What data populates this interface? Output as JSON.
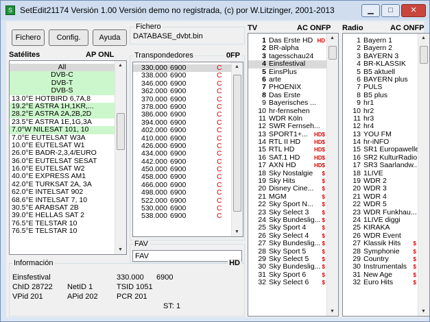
{
  "window": {
    "title": "SetEdit21174 Versión  1.00  Versión demo no registrada, (c) por W.Litzinger, 2001-2013",
    "min": "▁",
    "max": "□",
    "close": "✕"
  },
  "toolbar": {
    "fichero": "Fichero",
    "config": "Config.",
    "ayuda": "Ayuda",
    "file_group_label": "Fichero",
    "file_name": "DATABASE_dvbt.bin"
  },
  "satellites": {
    "label": "Satélites",
    "flags": "AP  ONL",
    "items": [
      {
        "t": "All",
        "c": "sel"
      },
      {
        "t": "DVB-C",
        "c": "green"
      },
      {
        "t": "DVB-T",
        "c": "green"
      },
      {
        "t": "DVB-S",
        "c": "green"
      },
      {
        "t": "13.0°E HOTBIRD 6,7A,8",
        "c": ""
      },
      {
        "t": "19.2°E ASTRA 1H,1KR,...",
        "c": "green"
      },
      {
        "t": "28.2°E ASTRA 2A,2B,2D",
        "c": "green"
      },
      {
        "t": "23.5°E ASTRA 1E,1G,3A",
        "c": ""
      },
      {
        "t": "7.0°W NILESAT 101, 10",
        "c": "green"
      },
      {
        "t": "7.0°E EUTELSAT W3A",
        "c": ""
      },
      {
        "t": "10.0°E EUTELSAT W1",
        "c": ""
      },
      {
        "t": "26.0°E BADR-2,3,4/EURO",
        "c": ""
      },
      {
        "t": "36.0°E EUTELSAT SESAT",
        "c": ""
      },
      {
        "t": "16.0°E EUTELSAT W2",
        "c": ""
      },
      {
        "t": "40.0°E EXPRESS AM1",
        "c": ""
      },
      {
        "t": "42.0°E TURKSAT 2A, 3A",
        "c": ""
      },
      {
        "t": "62.0°E INTELSAT 902",
        "c": ""
      },
      {
        "t": "68.6°E INTELSAT 7, 10",
        "c": ""
      },
      {
        "t": "30.5°E ARABSAT 2B",
        "c": ""
      },
      {
        "t": "39.0°E HELLAS SAT 2",
        "c": ""
      },
      {
        "t": "76.5°E TELSTAR 10",
        "c": ""
      },
      {
        "t": "76.5°E TELSTAR 10",
        "c": ""
      }
    ]
  },
  "transponders": {
    "label": "Transpondedores",
    "flags": "0FP",
    "items": [
      [
        "330.000",
        "6900",
        "C"
      ],
      [
        "338.000",
        "6900",
        "C"
      ],
      [
        "346.000",
        "6900",
        "C"
      ],
      [
        "362.000",
        "6900",
        "C"
      ],
      [
        "370.000",
        "6900",
        "C"
      ],
      [
        "378.000",
        "6900",
        "C"
      ],
      [
        "386.000",
        "6900",
        "C"
      ],
      [
        "394.000",
        "6900",
        "C"
      ],
      [
        "402.000",
        "6900",
        "C"
      ],
      [
        "410.000",
        "6900",
        "C"
      ],
      [
        "426.000",
        "6900",
        "C"
      ],
      [
        "434.000",
        "6900",
        "C"
      ],
      [
        "442.000",
        "6900",
        "C"
      ],
      [
        "450.000",
        "6900",
        "C"
      ],
      [
        "458.000",
        "6900",
        "C"
      ],
      [
        "466.000",
        "6900",
        "C"
      ],
      [
        "498.000",
        "6900",
        "C"
      ],
      [
        "522.000",
        "6900",
        "C"
      ],
      [
        "530.000",
        "6900",
        "C"
      ],
      [
        "538.000",
        "6900",
        "C"
      ]
    ]
  },
  "fav": {
    "label": "FAV",
    "value": "FAV"
  },
  "tv": {
    "label": "TV",
    "flags": "AC  ONFP",
    "items": [
      [
        "1",
        "Das Erste HD",
        "HD"
      ],
      [
        "2",
        "BR-alpha",
        ""
      ],
      [
        "3",
        "tagesschau24",
        ""
      ],
      [
        "4",
        "Einsfestival",
        ""
      ],
      [
        "5",
        "EinsPlus",
        ""
      ],
      [
        "6",
        "arte",
        ""
      ],
      [
        "7",
        "PHOENIX",
        ""
      ],
      [
        "8",
        "Das Erste",
        ""
      ],
      [
        "9",
        "Bayerisches ...",
        ""
      ],
      [
        "10",
        "hr-fernsehen",
        ""
      ],
      [
        "11",
        "WDR Köln",
        ""
      ],
      [
        "12",
        "SWR Fernseh...",
        ""
      ],
      [
        "13",
        "SPORT1+...",
        "HD$"
      ],
      [
        "14",
        "RTL II HD",
        "HD$"
      ],
      [
        "15",
        "RTL HD",
        "HD$"
      ],
      [
        "16",
        "SAT.1 HD",
        "HD$"
      ],
      [
        "17",
        "AXN HD",
        "HD$"
      ],
      [
        "18",
        "Sky Nostalgie",
        "$"
      ],
      [
        "19",
        "Sky Hits",
        "$"
      ],
      [
        "20",
        "Disney Cine...",
        "$"
      ],
      [
        "21",
        "MGM",
        "$"
      ],
      [
        "22",
        "Sky Sport N...",
        "$"
      ],
      [
        "23",
        "Sky Select 3",
        "$"
      ],
      [
        "24",
        "Sky Bundeslig...",
        "$"
      ],
      [
        "25",
        "Sky Sport 4",
        "$"
      ],
      [
        "26",
        "Sky Select 4",
        "$"
      ],
      [
        "27",
        "Sky Bundeslig...",
        "$"
      ],
      [
        "28",
        "Sky Sport 5",
        "$"
      ],
      [
        "29",
        "Sky Select 5",
        "$"
      ],
      [
        "30",
        "Sky Bundeslig...",
        "$"
      ],
      [
        "31",
        "Sky Sport 6",
        "$"
      ],
      [
        "32",
        "Sky Select 6",
        "$"
      ]
    ]
  },
  "radio": {
    "label": "Radio",
    "flags": "AC  ONFP",
    "items": [
      [
        "1",
        "Bayern 1",
        ""
      ],
      [
        "2",
        "Bayern 2",
        ""
      ],
      [
        "3",
        "BAYERN 3",
        ""
      ],
      [
        "4",
        "BR-KLASSIK",
        ""
      ],
      [
        "5",
        "B5 aktuell",
        ""
      ],
      [
        "6",
        "BAYERN plus",
        ""
      ],
      [
        "7",
        "PULS",
        ""
      ],
      [
        "8",
        "B5 plus",
        ""
      ],
      [
        "9",
        "hr1",
        ""
      ],
      [
        "10",
        "hr2",
        ""
      ],
      [
        "11",
        "hr3",
        ""
      ],
      [
        "12",
        "hr4",
        ""
      ],
      [
        "13",
        "YOU FM",
        ""
      ],
      [
        "14",
        "hr-iNFO",
        ""
      ],
      [
        "15",
        "SR1 Europawelle",
        ""
      ],
      [
        "16",
        "SR2 KulturRadio",
        ""
      ],
      [
        "17",
        "SR3 Saarlandw...",
        ""
      ],
      [
        "18",
        "1LIVE",
        ""
      ],
      [
        "19",
        "WDR 2",
        ""
      ],
      [
        "20",
        "WDR 3",
        ""
      ],
      [
        "21",
        "WDR 4",
        ""
      ],
      [
        "22",
        "WDR 5",
        ""
      ],
      [
        "23",
        "WDR Funkhau...",
        ""
      ],
      [
        "24",
        "1LIVE diggi",
        ""
      ],
      [
        "25",
        "KIRAKA",
        ""
      ],
      [
        "26",
        "WDR Event",
        ""
      ],
      [
        "27",
        "Klassik Hits",
        "$"
      ],
      [
        "28",
        "Symphonie",
        "$"
      ],
      [
        "29",
        "Country",
        "$"
      ],
      [
        "30",
        "Instrumentals",
        "$"
      ],
      [
        "31",
        "New Age",
        "$"
      ],
      [
        "32",
        "Euro Hits",
        "$"
      ]
    ]
  },
  "info": {
    "label": "Información",
    "flag": "HD",
    "name": "Einsfestival",
    "freq": "330.000",
    "sr": "6900",
    "chid": "ChID 28722",
    "netid": "NetID 1",
    "tsid": "TSID 1051",
    "vpid": "VPid 201",
    "apid": "APid 202",
    "pcr": "PCR 201",
    "st": "ST: 1"
  }
}
